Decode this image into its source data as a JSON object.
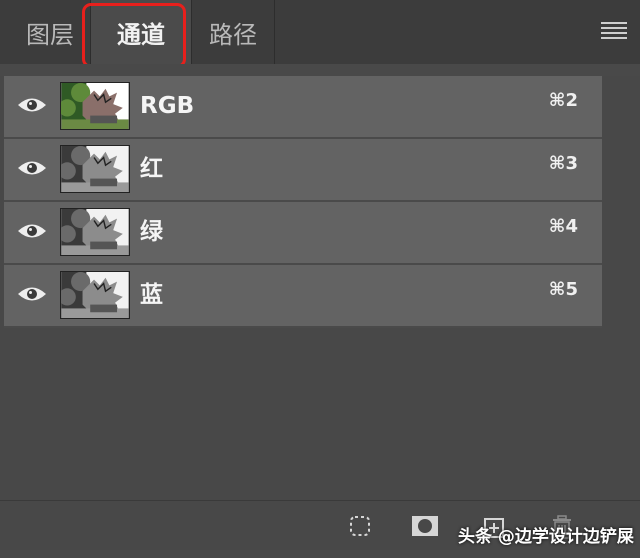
{
  "tabs": [
    {
      "label": "图层",
      "active": false
    },
    {
      "label": "通道",
      "active": true
    },
    {
      "label": "路径",
      "active": false
    }
  ],
  "channels": [
    {
      "name": "RGB",
      "shortcut": "⌘2",
      "thumb": "color"
    },
    {
      "name": "红",
      "shortcut": "⌘3",
      "thumb": "gray"
    },
    {
      "name": "绿",
      "shortcut": "⌘4",
      "thumb": "gray"
    },
    {
      "name": "蓝",
      "shortcut": "⌘5",
      "thumb": "gray"
    }
  ],
  "bottom_icons": [
    "load-selection-icon",
    "save-selection-icon",
    "new-channel-icon",
    "delete-channel-icon"
  ],
  "watermark": "头条 @边学设计边铲屎",
  "colors": {
    "highlight": "#e8201c",
    "panel": "#484848",
    "row": "#636363"
  }
}
